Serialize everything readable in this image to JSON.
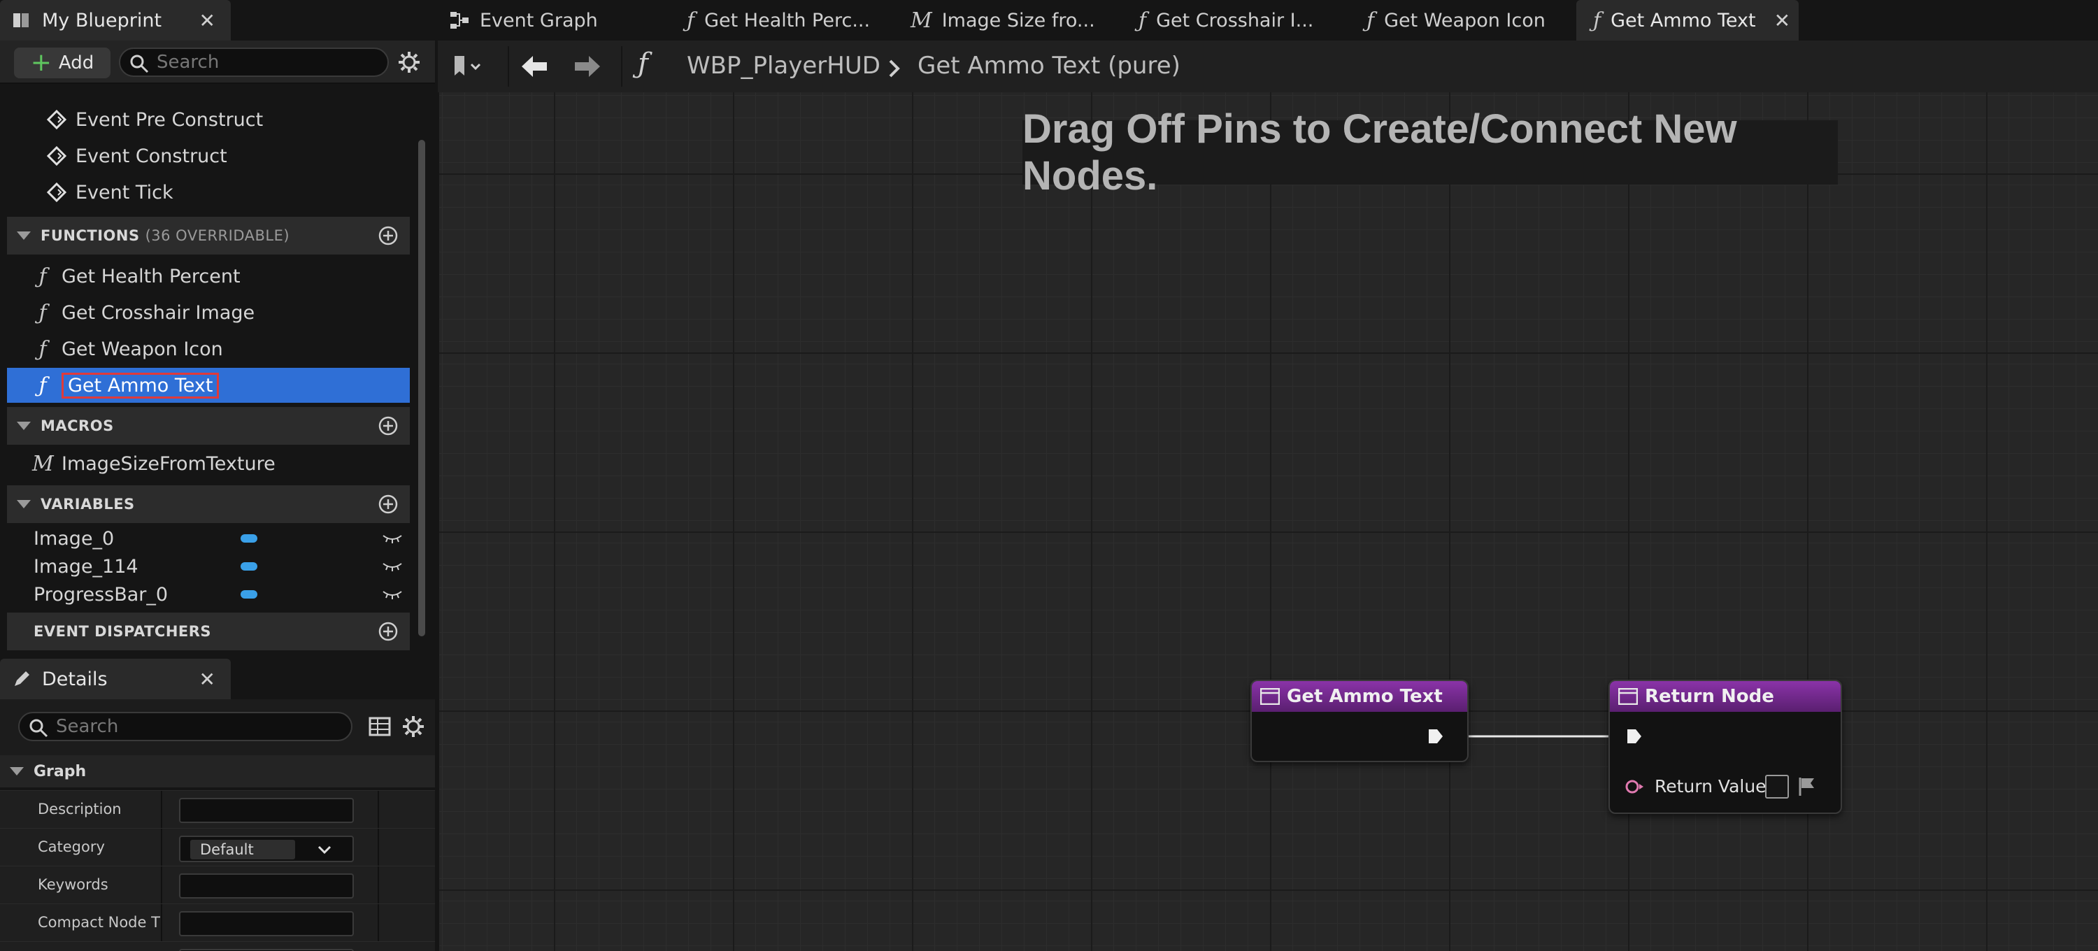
{
  "my_blueprint": {
    "tab_title": "My Blueprint",
    "add_label": "Add",
    "search_placeholder": "Search",
    "graphs": [
      "Event Pre Construct",
      "Event Construct",
      "Event Tick"
    ],
    "functions_header": "FUNCTIONS",
    "functions_sub": "(36 OVERRIDABLE)",
    "functions": [
      "Get Health Percent",
      "Get Crosshair Image",
      "Get Weapon Icon",
      "Get Ammo Text"
    ],
    "macros_header": "MACROS",
    "macros": [
      "ImageSizeFromTexture"
    ],
    "variables_header": "VARIABLES",
    "variables": [
      "Image_0",
      "Image_114",
      "ProgressBar_0"
    ],
    "dispatchers_header": "EVENT DISPATCHERS"
  },
  "details": {
    "tab_title": "Details",
    "search_placeholder": "Search",
    "graph_header": "Graph",
    "rows": {
      "description": "Description",
      "category": "Category",
      "category_value": "Default",
      "keywords": "Keywords",
      "compact_title": "Compact Node Titl"
    }
  },
  "tabs": [
    {
      "label": "Event Graph",
      "icon": "event-graph-icon"
    },
    {
      "label": "Get Health Perc...",
      "icon": "function-icon"
    },
    {
      "label": "Image Size fro...",
      "icon": "macro-icon"
    },
    {
      "label": "Get Crosshair I...",
      "icon": "function-icon"
    },
    {
      "label": "Get Weapon Icon",
      "icon": "function-icon"
    },
    {
      "label": "Get Ammo Text",
      "icon": "function-icon"
    }
  ],
  "breadcrumb": {
    "root": "WBP_PlayerHUD",
    "current": "Get Ammo Text (pure)"
  },
  "graph": {
    "hint": "Drag Off Pins to Create/Connect New Nodes.",
    "entry_node_title": "Get Ammo Text",
    "return_node_title": "Return Node",
    "return_value_label": "Return Value"
  },
  "colors": {
    "accent_selected": "#2f6fd6",
    "node_header": "#8a33a8",
    "variable_pin": "#3aa0e8",
    "text_pin": "#e07ab0",
    "add_plus": "#5fc75f"
  }
}
